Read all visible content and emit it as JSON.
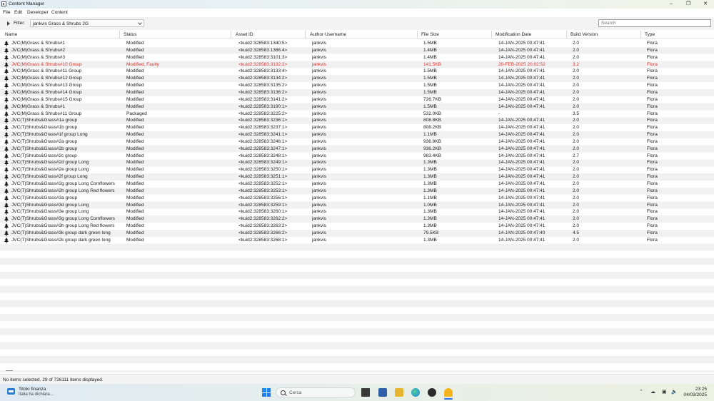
{
  "window": {
    "title": "Content Manager"
  },
  "menu": [
    "File",
    "Edit",
    "Developer",
    "Content"
  ],
  "filter": {
    "label": "Filter:",
    "value": "jankvis Grass & Shrubs 2G"
  },
  "search": {
    "placeholder": "Search"
  },
  "columns": [
    "Name",
    "Status",
    "Asset ID",
    "Author Username",
    "File Size",
    "Modification Date",
    "Build Version",
    "Type"
  ],
  "rows": [
    {
      "name": "JVC(M)Grass & Shrubs#1",
      "status": "Modified",
      "asset_id": "<kuid2:328583:1340:5>",
      "author": "jankvis",
      "size": "1.5MB",
      "date": "14-JAN-2025 00:47:41",
      "build": "2.0",
      "type": "Flora",
      "faulty": false
    },
    {
      "name": "JVC(M)Grass & Shrubs#2",
      "status": "Modified",
      "asset_id": "<kuid2:328583:1386:4>",
      "author": "jankvis",
      "size": "1.4MB",
      "date": "14-JAN-2025 00:47:41",
      "build": "2.0",
      "type": "Flora",
      "faulty": false
    },
    {
      "name": "JVC(M)Grass & Shrubs#3",
      "status": "Modified",
      "asset_id": "<kuid2:328583:3101:3>",
      "author": "jankvis",
      "size": "1.4MB",
      "date": "14-JAN-2025 00:47:41",
      "build": "2.0",
      "type": "Flora",
      "faulty": false
    },
    {
      "name": "JVC(M)Grass & Shrubs#10 Group",
      "status": "Modified, Faulty",
      "asset_id": "<kuid2:328583:3132:2>",
      "author": "jankvis",
      "size": "141.5KB",
      "date": "20-FEB-2025 20:02:52",
      "build": "3.2",
      "type": "Flora",
      "faulty": true
    },
    {
      "name": "JVC(M)Grass & Shrubs#11 Group",
      "status": "Modified",
      "asset_id": "<kuid2:328583:3133:4>",
      "author": "jankvis",
      "size": "1.5MB",
      "date": "14-JAN-2025 00:47:41",
      "build": "2.0",
      "type": "Flora",
      "faulty": false
    },
    {
      "name": "JVC(M)Grass & Shrubs#12 Group",
      "status": "Modified",
      "asset_id": "<kuid2:328583:3134:2>",
      "author": "jankvis",
      "size": "1.5MB",
      "date": "14-JAN-2025 00:47:41",
      "build": "2.0",
      "type": "Flora",
      "faulty": false
    },
    {
      "name": "JVC(M)Grass & Shrubs#13 Group",
      "status": "Modified",
      "asset_id": "<kuid2:328583:3135:2>",
      "author": "jankvis",
      "size": "1.5MB",
      "date": "14-JAN-2025 00:47:41",
      "build": "2.0",
      "type": "Flora",
      "faulty": false
    },
    {
      "name": "JVC(M)Grass & Shrubs#14 Group",
      "status": "Modified",
      "asset_id": "<kuid2:328583:3136:2>",
      "author": "jankvis",
      "size": "1.5MB",
      "date": "14-JAN-2025 00:47:41",
      "build": "2.0",
      "type": "Flora",
      "faulty": false
    },
    {
      "name": "JVC(M)Grass & Shrubs#15 Group",
      "status": "Modified",
      "asset_id": "<kuid2:328583:3141:2>",
      "author": "jankvis",
      "size": "726.7KB",
      "date": "14-JAN-2025 00:47:41",
      "build": "2.0",
      "type": "Flora",
      "faulty": false
    },
    {
      "name": "JVC(M)Grass & Shrubs#1",
      "status": "Modified",
      "asset_id": "<kuid2:328583:3190:1>",
      "author": "jankvis",
      "size": "1.5MB",
      "date": "14-JAN-2025 00:47:41",
      "build": "2.0",
      "type": "Flora",
      "faulty": false
    },
    {
      "name": "JVC(M)Grass & Shrubs#11 Group",
      "status": "Packaged",
      "asset_id": "<kuid2:328583:3225:2>",
      "author": "jankvis",
      "size": "532.0KB",
      "date": "-",
      "build": "3.5",
      "type": "Flora",
      "faulty": false
    },
    {
      "name": "JVC(T)Shrubs&Grass#1a group",
      "status": "Modified",
      "asset_id": "<kuid2:328583:3236:1>",
      "author": "jankvis",
      "size": "808.8KB",
      "date": "14-JAN-2025 00:47:41",
      "build": "2.0",
      "type": "Flora",
      "faulty": false
    },
    {
      "name": "JVC(T)Shrubs&Grass#1b group",
      "status": "Modified",
      "asset_id": "<kuid2:328583:3237:1>",
      "author": "jankvis",
      "size": "808.2KB",
      "date": "14-JAN-2025 00:47:41",
      "build": "2.0",
      "type": "Flora",
      "faulty": false
    },
    {
      "name": "JVC(T)Shrubs&Grass#1f group Long",
      "status": "Modified",
      "asset_id": "<kuid2:328583:3241:1>",
      "author": "jankvis",
      "size": "1.1MB",
      "date": "14-JAN-2025 00:47:41",
      "build": "2.0",
      "type": "Flora",
      "faulty": false
    },
    {
      "name": "JVC(T)Shrubs&Grass#2a group",
      "status": "Modified",
      "asset_id": "<kuid2:328583:3246:1>",
      "author": "jankvis",
      "size": "936.8KB",
      "date": "14-JAN-2025 00:47:41",
      "build": "2.0",
      "type": "Flora",
      "faulty": false
    },
    {
      "name": "JVC(T)Shrubs&Grass#2b group",
      "status": "Modified",
      "asset_id": "<kuid2:328583:3247:1>",
      "author": "jankvis",
      "size": "936.2KB",
      "date": "14-JAN-2025 00:47:41",
      "build": "2.0",
      "type": "Flora",
      "faulty": false
    },
    {
      "name": "JVC(T)Shrubs&Grass#2c group",
      "status": "Modified",
      "asset_id": "<kuid2:328583:3248:1>",
      "author": "jankvis",
      "size": "983.4KB",
      "date": "14-JAN-2025 00:47:41",
      "build": "2.7",
      "type": "Flora",
      "faulty": false
    },
    {
      "name": "JVC(T)Shrubs&Grass#2d group Long",
      "status": "Modified",
      "asset_id": "<kuid2:328583:3249:1>",
      "author": "jankvis",
      "size": "1.3MB",
      "date": "14-JAN-2025 00:47:41",
      "build": "2.0",
      "type": "Flora",
      "faulty": false
    },
    {
      "name": "JVC(T)Shrubs&Grass#2e group Long",
      "status": "Modified",
      "asset_id": "<kuid2:328583:3250:1>",
      "author": "jankvis",
      "size": "1.3MB",
      "date": "14-JAN-2025 00:47:41",
      "build": "2.0",
      "type": "Flora",
      "faulty": false
    },
    {
      "name": "JVC(T)Shrubs&Grass#2f group Long",
      "status": "Modified",
      "asset_id": "<kuid2:328583:3251:1>",
      "author": "jankvis",
      "size": "1.3MB",
      "date": "14-JAN-2025 00:47:41",
      "build": "2.0",
      "type": "Flora",
      "faulty": false
    },
    {
      "name": "JVC(T)Shrubs&Grass#2g group Long Cornflowers",
      "status": "Modified",
      "asset_id": "<kuid2:328583:3252:1>",
      "author": "jankvis",
      "size": "1.3MB",
      "date": "14-JAN-2025 00:47:41",
      "build": "2.0",
      "type": "Flora",
      "faulty": false
    },
    {
      "name": "JVC(T)Shrubs&Grass#2h group Long Red flowers",
      "status": "Modified",
      "asset_id": "<kuid2:328583:3253:1>",
      "author": "jankvis",
      "size": "1.3MB",
      "date": "14-JAN-2025 00:47:41",
      "build": "2.0",
      "type": "Flora",
      "faulty": false
    },
    {
      "name": "JVC(T)Shrubs&Grass#3a group",
      "status": "Modified",
      "asset_id": "<kuid2:328583:3256:1>",
      "author": "jankvis",
      "size": "1.1MB",
      "date": "14-JAN-2025 00:47:41",
      "build": "2.0",
      "type": "Flora",
      "faulty": false
    },
    {
      "name": "JVC(T)Shrubs&Grass#3d group Long",
      "status": "Modified",
      "asset_id": "<kuid2:328583:3259:1>",
      "author": "jankvis",
      "size": "1.0MB",
      "date": "14-JAN-2025 00:47:41",
      "build": "2.0",
      "type": "Flora",
      "faulty": false
    },
    {
      "name": "JVC(T)Shrubs&Grass#3e group Long",
      "status": "Modified",
      "asset_id": "<kuid2:328583:3260:1>",
      "author": "jankvis",
      "size": "1.3MB",
      "date": "14-JAN-2025 00:47:41",
      "build": "2.0",
      "type": "Flora",
      "faulty": false
    },
    {
      "name": "JVC(T)Shrubs&Grass#3g group Long Cornflowers",
      "status": "Modified",
      "asset_id": "<kuid2:328583:3262:2>",
      "author": "jankvis",
      "size": "1.3MB",
      "date": "14-JAN-2025 00:47:41",
      "build": "2.0",
      "type": "Flora",
      "faulty": false
    },
    {
      "name": "JVC(T)Shrubs&Grass#3h group Long Red flowers",
      "status": "Modified",
      "asset_id": "<kuid2:328583:3263:2>",
      "author": "jankvis",
      "size": "1.3MB",
      "date": "14-JAN-2025 00:47:41",
      "build": "2.0",
      "type": "Flora",
      "faulty": false
    },
    {
      "name": "JVC(T)Shrubs&Grass#3k group dark green long",
      "status": "Modified",
      "asset_id": "<kuid2:328583:3266:2>",
      "author": "jankvis",
      "size": "79.5KB",
      "date": "14-JAN-2025 00:47:40",
      "build": "4.5",
      "type": "Flora",
      "faulty": false
    },
    {
      "name": "JVC(T)Shrubs&Grass#2k group dark green long",
      "status": "Modified",
      "asset_id": "<kuid2:328583:3268:1>",
      "author": "jankvis",
      "size": "1.3MB",
      "date": "14-JAN-2025 00:47:41",
      "build": "2.0",
      "type": "Flora",
      "faulty": false
    }
  ],
  "status_bar": "No items selected. 29 of 726111 items displayed.",
  "taskbar": {
    "widget_title": "Titolo finanza",
    "widget_sub": "Italia ha dichiara...",
    "search_label": "Cerca",
    "time": "23:25",
    "date": "04/03/2025"
  },
  "colors": {
    "faulty": "#d9342b",
    "accent": "#2b6ee0"
  }
}
